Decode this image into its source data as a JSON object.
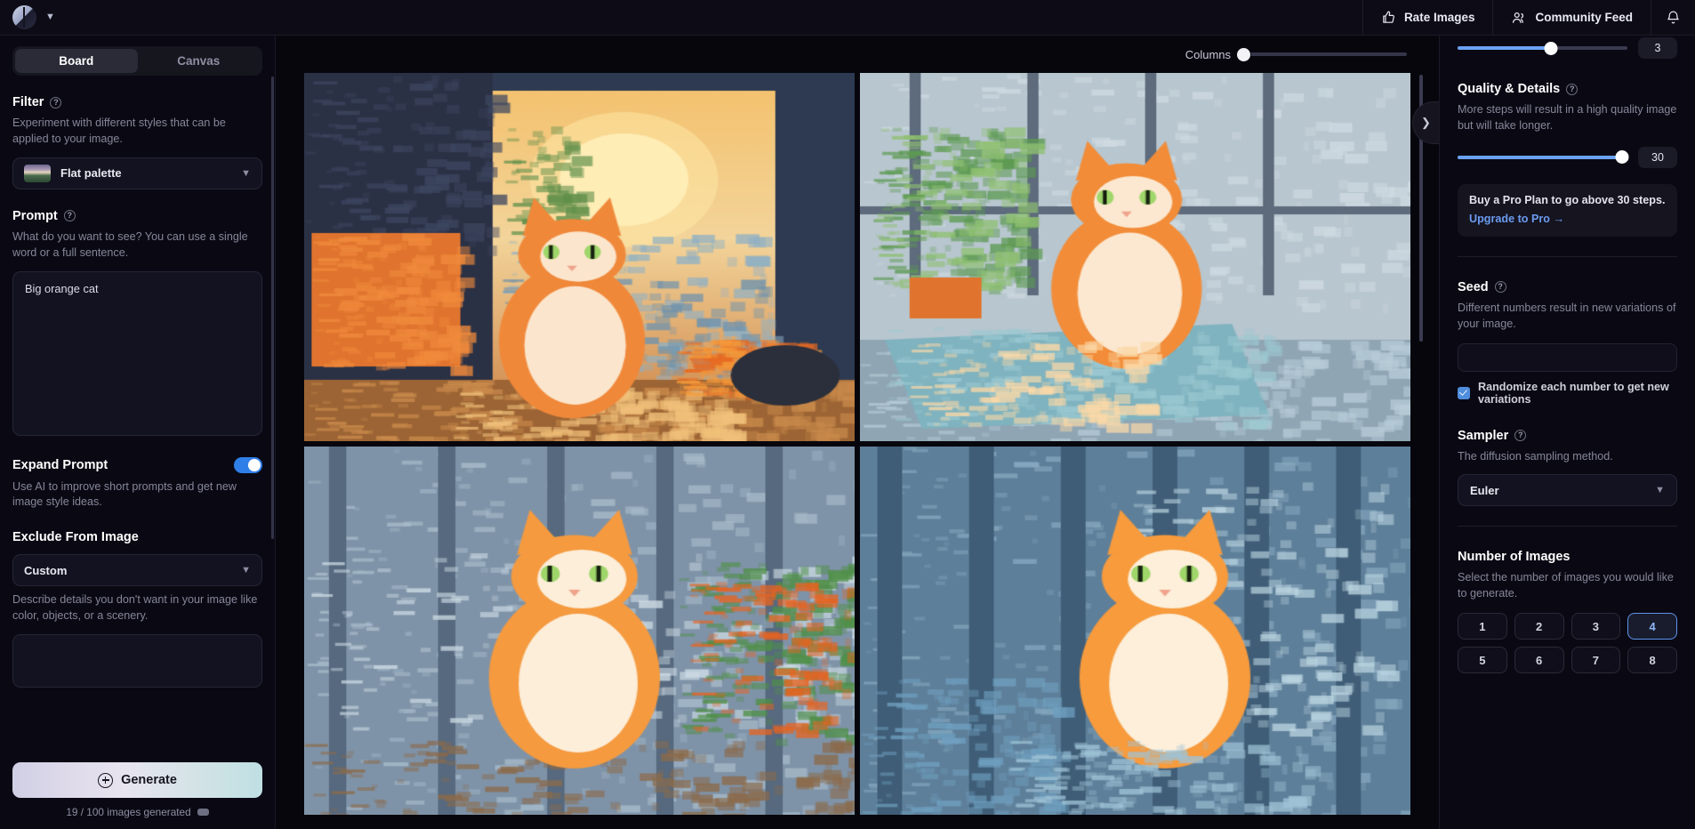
{
  "topbar": {
    "logo_icon": "app-logo-icon",
    "dropdown_icon": "chevron-down-icon",
    "actions": [
      {
        "label": "Rate Images",
        "icon": "thumbs-up-icon"
      },
      {
        "label": "Community Feed",
        "icon": "people-icon"
      },
      {
        "label": "",
        "icon": "bell-icon"
      }
    ]
  },
  "sidebar": {
    "tabs": [
      {
        "label": "Board",
        "active": true
      },
      {
        "label": "Canvas",
        "active": false
      }
    ],
    "filter": {
      "title": "Filter",
      "help_icon": "question-circle-icon",
      "description": "Experiment with different styles that can be applied to your image.",
      "selected": "Flat palette",
      "chevron": "⌄"
    },
    "prompt": {
      "title": "Prompt",
      "help_icon": "question-circle-icon",
      "description": "What do you want to see? You can use a single word or a full sentence.",
      "value": "Big orange cat",
      "placeholder": "Big orange cat"
    },
    "expand_prompt": {
      "title": "Expand Prompt",
      "description": "Use AI to improve short prompts and get new image style ideas.",
      "enabled": true
    },
    "exclude": {
      "title": "Exclude From Image",
      "selected": "Custom",
      "description": "Describe details you don't want in your image like color, objects, or a scenery."
    },
    "generate": {
      "label": "Generate",
      "icon": "plus-circle-icon",
      "meta": "19 / 100 images generated",
      "meta_icon": "credits-pill-icon"
    }
  },
  "main": {
    "columns": {
      "label": "Columns",
      "value": 1,
      "min": 1,
      "max": 6,
      "percent": 0
    },
    "expander_icon": "chevron-right-icon",
    "images": [
      {
        "alt": "orange cat standing by window at sunset",
        "variant": "sunset-window"
      },
      {
        "alt": "orange cat sitting on blue cushion",
        "variant": "blue-cushion"
      },
      {
        "alt": "orange cat sitting in front of flowers",
        "variant": "flowers-city"
      },
      {
        "alt": "orange cat in blue city alley",
        "variant": "blue-alley"
      }
    ]
  },
  "right_panel": {
    "guidance_slider": {
      "value": 3,
      "percent": 55,
      "accent": "#6ba2f5"
    },
    "quality": {
      "title": "Quality & Details",
      "help_icon": "question-circle-icon",
      "description": "More steps will result in a high quality image but will take longer.",
      "value": 30,
      "percent": 97
    },
    "promo": {
      "text": "Buy a Pro Plan to go above 30 steps.",
      "link": "Upgrade to Pro →"
    },
    "seed": {
      "title": "Seed",
      "help_icon": "question-circle-icon",
      "description": "Different numbers result in new variations of your image.",
      "value": "",
      "randomize_label": "Randomize each number to get new variations",
      "randomize_checked": true
    },
    "sampler": {
      "title": "Sampler",
      "help_icon": "question-circle-icon",
      "description": "The diffusion sampling method.",
      "selected": "Euler",
      "chevron": "⌄"
    },
    "number_of_images": {
      "title": "Number of Images",
      "description": "Select the number of images you would like to generate.",
      "options": [
        "1",
        "2",
        "3",
        "4",
        "5",
        "6",
        "7",
        "8"
      ],
      "selected": "4"
    }
  }
}
